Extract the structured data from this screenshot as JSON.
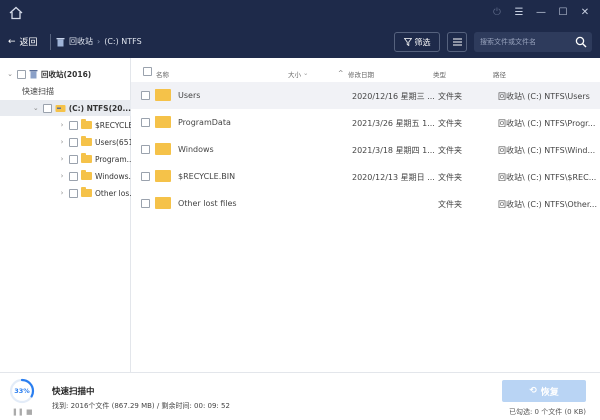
{
  "titlebar": {
    "icons": [
      "home-icon",
      "help-icon",
      "menu-icon",
      "minimize-icon",
      "maximize-icon",
      "close-icon"
    ]
  },
  "toolbar": {
    "back_label": "返回",
    "breadcrumb_bin": "回收站",
    "breadcrumb_drive": "(C:) NTFS",
    "filter_label": "筛选",
    "search_placeholder": "搜索文件或文件名"
  },
  "sidebar": {
    "root_label": "回收站(2016)",
    "scan_label": "快速扫描",
    "drive_label": "(C:) NTFS(20...",
    "folders": [
      {
        "label": "$RECYCLE..."
      },
      {
        "label": "Users(651)"
      },
      {
        "label": "Program..."
      },
      {
        "label": "Windows..."
      },
      {
        "label": "Other los..."
      }
    ]
  },
  "table": {
    "headers": {
      "name": "名称",
      "size": "大小",
      "date": "修改日期",
      "type": "类型",
      "path": "路径"
    },
    "rows": [
      {
        "name": "Users",
        "date": "2020/12/16 星期三 ...",
        "type": "文件夹",
        "path": "回收站\\ (C:) NTFS\\Users"
      },
      {
        "name": "ProgramData",
        "date": "2021/3/26 星期五 1...",
        "type": "文件夹",
        "path": "回收站\\ (C:) NTFS\\Progr..."
      },
      {
        "name": "Windows",
        "date": "2021/3/18 星期四 1...",
        "type": "文件夹",
        "path": "回收站\\ (C:) NTFS\\Wind..."
      },
      {
        "name": "$RECYCLE.BIN",
        "date": "2020/12/13 星期日 ...",
        "type": "文件夹",
        "path": "回收站\\ (C:) NTFS\\$REC..."
      },
      {
        "name": "Other lost files",
        "date": "",
        "type": "文件夹",
        "path": "回收站\\ (C:) NTFS\\Other..."
      }
    ]
  },
  "footer": {
    "progress_text": "33%",
    "progress_fraction": 0.33,
    "status_title": "快速扫描中",
    "found_line": "找到:  2016个文件 (867.29 MB) / 剩余时间:  00: 09: 52",
    "recover_label": "恢复",
    "selected_info": "已勾选: 0 个文件 (0 KB)",
    "accent": "#2a7ef0"
  }
}
